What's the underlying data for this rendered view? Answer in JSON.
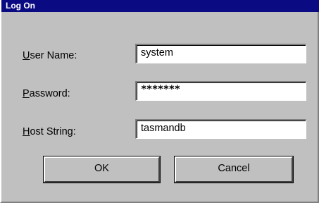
{
  "window": {
    "title": "Log On"
  },
  "form": {
    "user_name": {
      "label_mnemonic": "U",
      "label_rest": "ser Name:",
      "value": "system"
    },
    "password": {
      "label_mnemonic": "P",
      "label_rest": "assword:",
      "value": "*******"
    },
    "host_string": {
      "label_mnemonic": "H",
      "label_rest": "ost String:",
      "value": "tasmandb"
    }
  },
  "buttons": {
    "ok_label": "OK",
    "cancel_label": "Cancel"
  },
  "colors": {
    "titlebar": "#0a0a82",
    "dialog_background": "#c0c0c0",
    "field_background": "#ffffff"
  }
}
